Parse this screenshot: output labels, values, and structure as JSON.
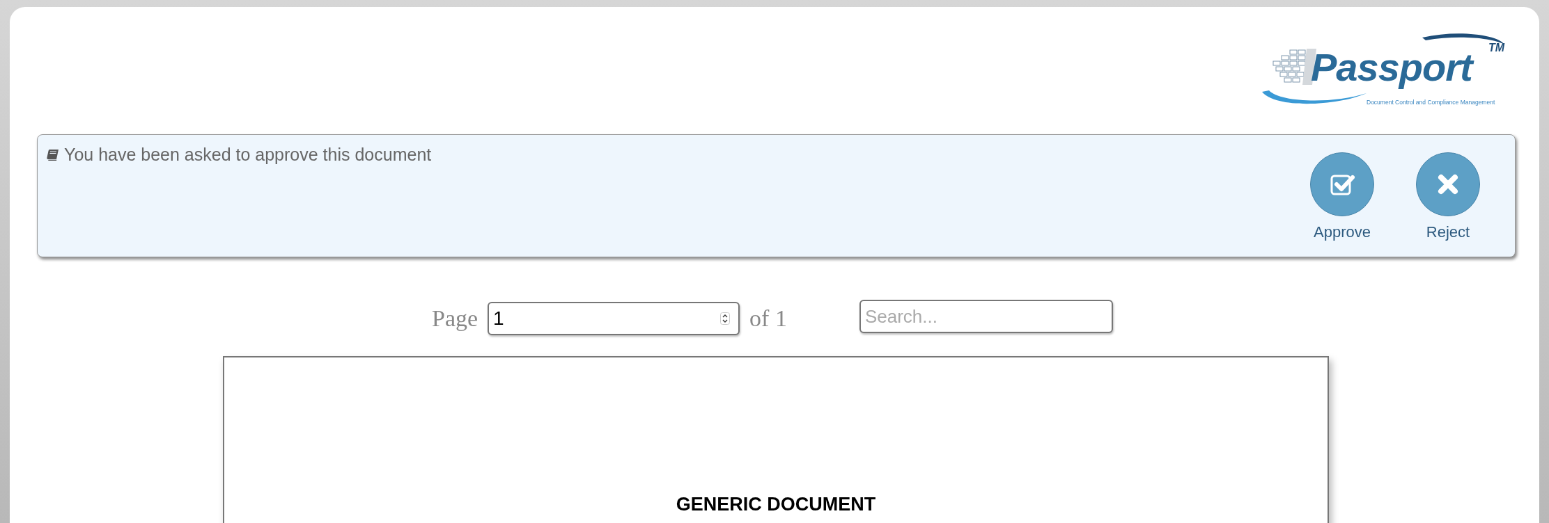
{
  "logo": {
    "wordmark": "Passport",
    "trademark": "TM",
    "tagline": "Document Control and Compliance Management"
  },
  "banner": {
    "message": "You have been asked to approve this document",
    "actions": [
      {
        "label": "Approve",
        "kind": "approve"
      },
      {
        "label": "Reject",
        "kind": "reject"
      }
    ]
  },
  "pager": {
    "label": "Page",
    "value": "1",
    "total": "of 1"
  },
  "search": {
    "placeholder": "Search..."
  },
  "document": {
    "title": "GENERIC DOCUMENT"
  }
}
